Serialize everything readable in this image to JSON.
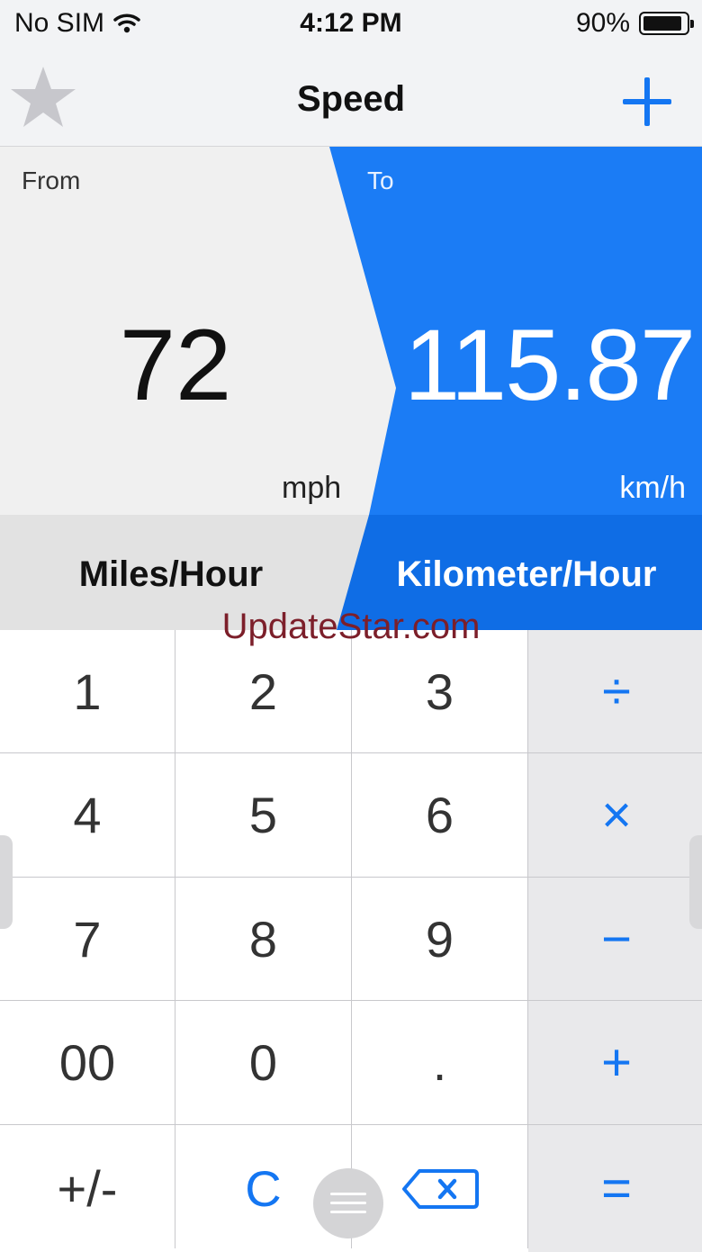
{
  "status_bar": {
    "carrier": "No SIM",
    "time": "4:12 PM",
    "battery": "90%",
    "battery_level": 0.9
  },
  "nav": {
    "title": "Speed",
    "left_icon": "star-icon",
    "right_icon": "plus-icon"
  },
  "converter": {
    "from_label": "From",
    "to_label": "To",
    "from_value": "72",
    "to_value": "115.87",
    "from_unit_abbr": "mph",
    "to_unit_abbr": "km/h",
    "from_unit_name": "Miles/Hour",
    "to_unit_name": "Kilometer/Hour"
  },
  "watermark": "UpdateStar.com",
  "keypad": {
    "k1": "1",
    "k2": "2",
    "k3": "3",
    "divide": "÷",
    "k4": "4",
    "k5": "5",
    "k6": "6",
    "multiply": "×",
    "k7": "7",
    "k8": "8",
    "k9": "9",
    "minus": "−",
    "k00": "00",
    "k0": "0",
    "dot": ".",
    "plus": "+",
    "sign": "+/-",
    "clear": "C",
    "delete_icon": "delete-icon",
    "equals": "="
  },
  "colors": {
    "accent": "#1476f2",
    "background": "#f0f0f0",
    "watermark": "#7c1f2a"
  }
}
